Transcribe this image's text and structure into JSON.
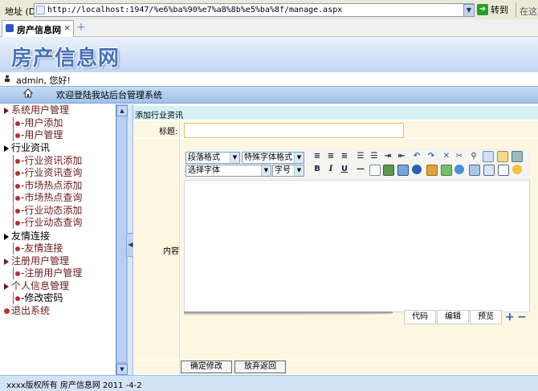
{
  "browser": {
    "address_label": "地址 (D)",
    "url": "http://localhost:1947/%e6%ba%90%e7%a8%8b%e5%ba%8f/manage.aspx",
    "go_label": "转到",
    "go_extra": "在这",
    "tab_title": "房产信息网",
    "tab_close": "×",
    "new_tab": "+"
  },
  "banner": {
    "logo": "房产信息网"
  },
  "user": {
    "greeting": "admin, 您好!"
  },
  "nav": {
    "welcome": "欢迎登陆我站后台管理系统"
  },
  "sidebar": {
    "items": [
      {
        "label": "系统用户管理",
        "level": "top"
      },
      {
        "label": "-用户添加",
        "level": "child"
      },
      {
        "label": "-用户管理",
        "level": "child"
      },
      {
        "label": "行业资讯",
        "level": "top"
      },
      {
        "label": "-行业资讯添加",
        "level": "child"
      },
      {
        "label": "-行业资讯查询",
        "level": "child"
      },
      {
        "label": "-市场热点添加",
        "level": "child"
      },
      {
        "label": "-市场热点查询",
        "level": "child"
      },
      {
        "label": "-行业动态添加",
        "level": "child"
      },
      {
        "label": "-行业动态查询",
        "level": "child"
      },
      {
        "label": "友情连接",
        "level": "top"
      },
      {
        "label": "-友情连接",
        "level": "child"
      },
      {
        "label": "注册用户管理",
        "level": "top"
      },
      {
        "label": "-注册用户管理",
        "level": "child"
      },
      {
        "label": "个人信息管理",
        "level": "top"
      },
      {
        "label": "-修改密码",
        "level": "child"
      },
      {
        "label": "退出系统",
        "level": "top"
      }
    ]
  },
  "form": {
    "section_title": "添加行业资讯",
    "title_label": "标题:",
    "title_value": "",
    "content_label": "内容",
    "submit": "确定修改",
    "cancel": "放弃返回"
  },
  "editor": {
    "paragraph_format": "段落格式",
    "special_format": "特殊字体格式",
    "font_select": "选择字体",
    "font_size": "字号",
    "bold": "B",
    "italic": "I",
    "underline": "U",
    "mode_code": "代码",
    "mode_edit": "编辑",
    "mode_preview": "预览",
    "zoom_in": "+",
    "zoom_out": "−"
  },
  "footer": {
    "text": "xxxx版权所有 房产信息网 2011 -4-2"
  }
}
